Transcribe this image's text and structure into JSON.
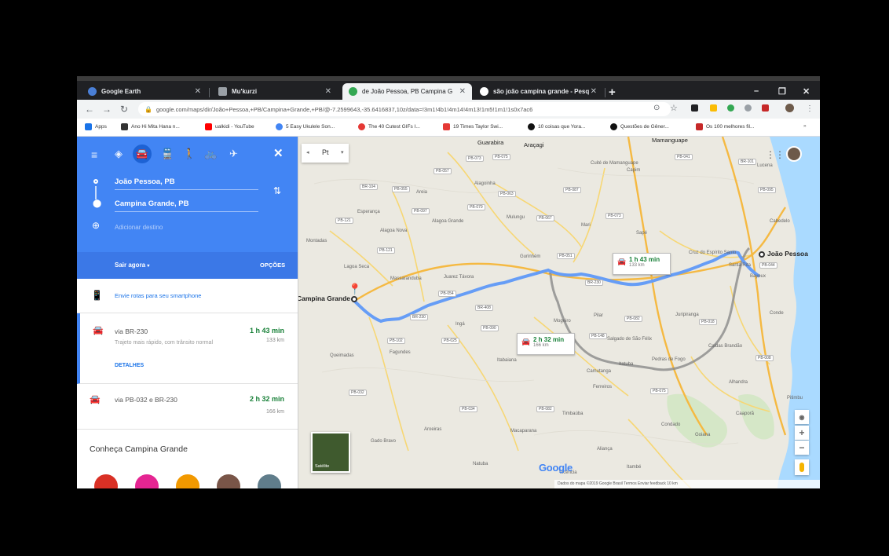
{
  "browser": {
    "tabs": [
      {
        "label": "Google Earth",
        "favicon_color": "#4a7fd6"
      },
      {
        "label": "Mu'kurzi",
        "favicon_color": "#9aa0a6"
      },
      {
        "label": "de João Pessoa, PB Campina G",
        "favicon_color": "#34a853"
      },
      {
        "label": "são joão campina grande - Pesq",
        "favicon_color": "#ffffff"
      }
    ],
    "url": "google.com/maps/dir/João+Pessoa,+PB/Campina+Grande,+PB/@-7.2599643,-35.6416837,10z/data=!3m1!4b1!4m14!4m13!1m5!1m1!1s0x7ac6",
    "bookmarks": [
      {
        "label": "Apps",
        "color": "#1a73e8"
      },
      {
        "label": "Ano Hi Mita Hana n...",
        "color": "#333333"
      },
      {
        "label": "ualkidi - YouTube",
        "color": "#ff0000"
      },
      {
        "label": "5 Easy Ukulele Son...",
        "color": "#4285f4"
      },
      {
        "label": "The 40 Cutest GIFs I...",
        "color": "#e53935"
      },
      {
        "label": "19 Times Taylor Swi...",
        "color": "#e53935"
      },
      {
        "label": "10 coisas que Yora...",
        "color": "#111111"
      },
      {
        "label": "Questões de Gêner...",
        "color": "#111111"
      },
      {
        "label": "Os 100 melhores fil...",
        "color": "#c62828"
      }
    ]
  },
  "panel": {
    "origin": "João Pessoa, PB",
    "destination": "Campina Grande, PB",
    "add_destination": "Adicionar destino",
    "depart": "Sair agora",
    "options": "OPÇÕES",
    "send_to_phone": "Envie rotas para seu smartphone",
    "routes": [
      {
        "via": "via BR-230",
        "duration": "1 h 43 min",
        "distance": "133 km",
        "desc": "Trajeto mais rápido, com trânsito normal",
        "details": "DETALHES"
      },
      {
        "via": "via PB-032 e BR-230",
        "duration": "2 h 32 min",
        "distance": "166 km"
      }
    ],
    "explore_title": "Conheça Campina Grande"
  },
  "map": {
    "language_selector": "Pt",
    "origin_label": "João Pessoa",
    "destination_label": "Campina Grande",
    "callout_main": {
      "duration": "1 h 43 min",
      "distance": "133 km"
    },
    "callout_alt": {
      "duration": "2 h 32 min",
      "distance": "166 km"
    },
    "satellite_label": "Satélite",
    "google_logo": "Google",
    "footer": "Dados do mapa ©2019 Google   Brasil   Termos   Enviar feedback   10 km",
    "places": [
      "Guarabira",
      "Araçagi",
      "Mamanguape",
      "Cuité de Mamanguape",
      "Capim",
      "Lucena",
      "Alagoinha",
      "Mulungu",
      "Mari",
      "Sapé",
      "Cabedelo",
      "Esperança",
      "Alagoa Nova",
      "Alagoa Grande",
      "Areia",
      "Montadas",
      "Lagoa Seca",
      "Massaranduba",
      "Juarez Távora",
      "Gurinhém",
      "Ingá",
      "Pilar",
      "Itabaiana",
      "Fagundes",
      "Queimadas",
      "Mogeiro",
      "Salgado de São Félix",
      "Juripiranga",
      "Caldas Brandão",
      "Itatuba",
      "Pedras de Fogo",
      "Alhandra",
      "Caaporã",
      "Pitimbu",
      "Timbaúba",
      "Macaparana",
      "Aliança",
      "Goiana",
      "Condado",
      "Camutanga",
      "Ferreiros",
      "Gado Bravo",
      "Natuba",
      "Aroeiras",
      "Vicência",
      "Itambé",
      "Conde",
      "Santa Rita",
      "Bayeux",
      "Cruz do Espírito Santo"
    ],
    "shields": [
      "PB-073",
      "PB-075",
      "PB-041",
      "PB-057",
      "PB-055",
      "PB-063",
      "PB-067",
      "PB-073",
      "PB-121",
      "PB-097",
      "PB-079",
      "PB-087",
      "PB-121",
      "PB-051",
      "PB-095",
      "PB-082",
      "PB-054",
      "PB-090",
      "PB-008",
      "PB-044",
      "PB-018",
      "PB-025",
      "PB-102",
      "PB-148",
      "PB-082",
      "PB-075",
      "PB-034",
      "PB-032",
      "BR-101",
      "BR-230",
      "BR-104",
      "BR-408",
      "BR-230"
    ]
  }
}
